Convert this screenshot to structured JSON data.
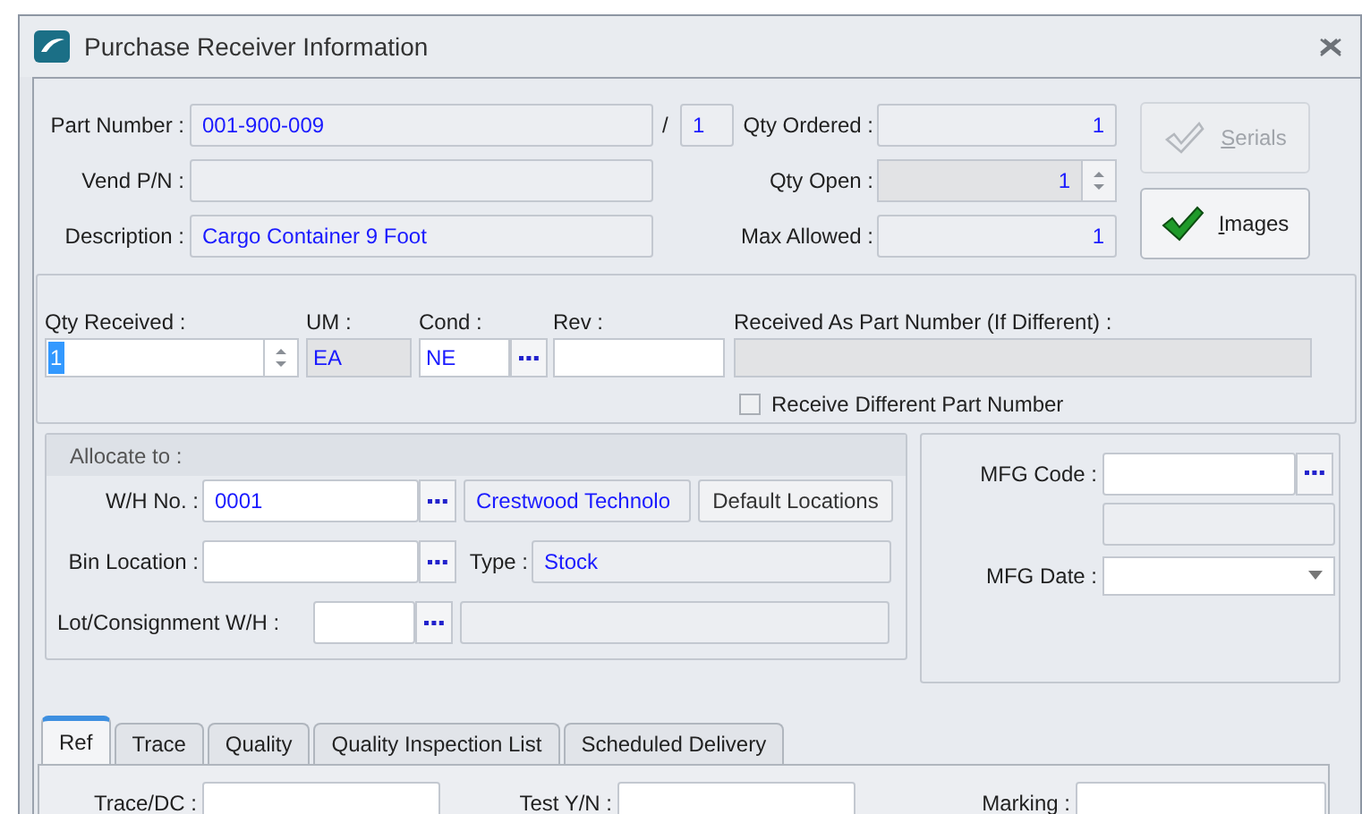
{
  "window": {
    "title": "Purchase Receiver Information"
  },
  "header": {
    "part_number": {
      "label": "Part Number :",
      "value": "001-900-009"
    },
    "separator": "/",
    "line_value": "1",
    "vend_pn": {
      "label": "Vend P/N :"
    },
    "description": {
      "label": "Description :",
      "value": "Cargo Container 9 Foot"
    },
    "qty_ordered": {
      "label": "Qty Ordered :",
      "value": "1"
    },
    "qty_open": {
      "label": "Qty Open :",
      "value": "1"
    },
    "max_allowed": {
      "label": "Max Allowed :",
      "value": "1"
    },
    "buttons": [
      {
        "label": "Serials",
        "disabled": true
      },
      {
        "label": "Images",
        "disabled": false
      }
    ]
  },
  "receive": {
    "qty_received": {
      "label": "Qty Received :",
      "value": "1"
    },
    "um": {
      "label": "UM :",
      "value": "EA"
    },
    "cond": {
      "label": "Cond :",
      "value": "NE"
    },
    "rev": {
      "label": "Rev :"
    },
    "received_as": {
      "label": "Received As Part Number (If Different) :"
    },
    "receive_different": {
      "label": "Receive Different Part Number",
      "checked": false
    }
  },
  "allocate": {
    "title": "Allocate to :",
    "wh_no": {
      "label": "W/H No. :",
      "value": "0001"
    },
    "wh_name": "Crestwood Technolo",
    "default_locations": "Default Locations",
    "bin_location": {
      "label": "Bin Location :"
    },
    "type": {
      "label": "Type :",
      "value": "Stock"
    },
    "lot": {
      "label": "Lot/Consignment W/H :"
    }
  },
  "mfg": {
    "code": {
      "label": "MFG Code :"
    },
    "date": {
      "label": "MFG Date :"
    }
  },
  "tabs": [
    {
      "label": "Ref",
      "selected": true
    },
    {
      "label": "Trace",
      "selected": false
    },
    {
      "label": "Quality",
      "selected": false
    },
    {
      "label": "Quality Inspection List",
      "selected": false
    },
    {
      "label": "Scheduled Delivery",
      "selected": false
    }
  ],
  "ref_fields": [
    {
      "label": "Trace/DC :"
    },
    {
      "label": "Test Y/N :"
    },
    {
      "label": "Marking :"
    }
  ]
}
